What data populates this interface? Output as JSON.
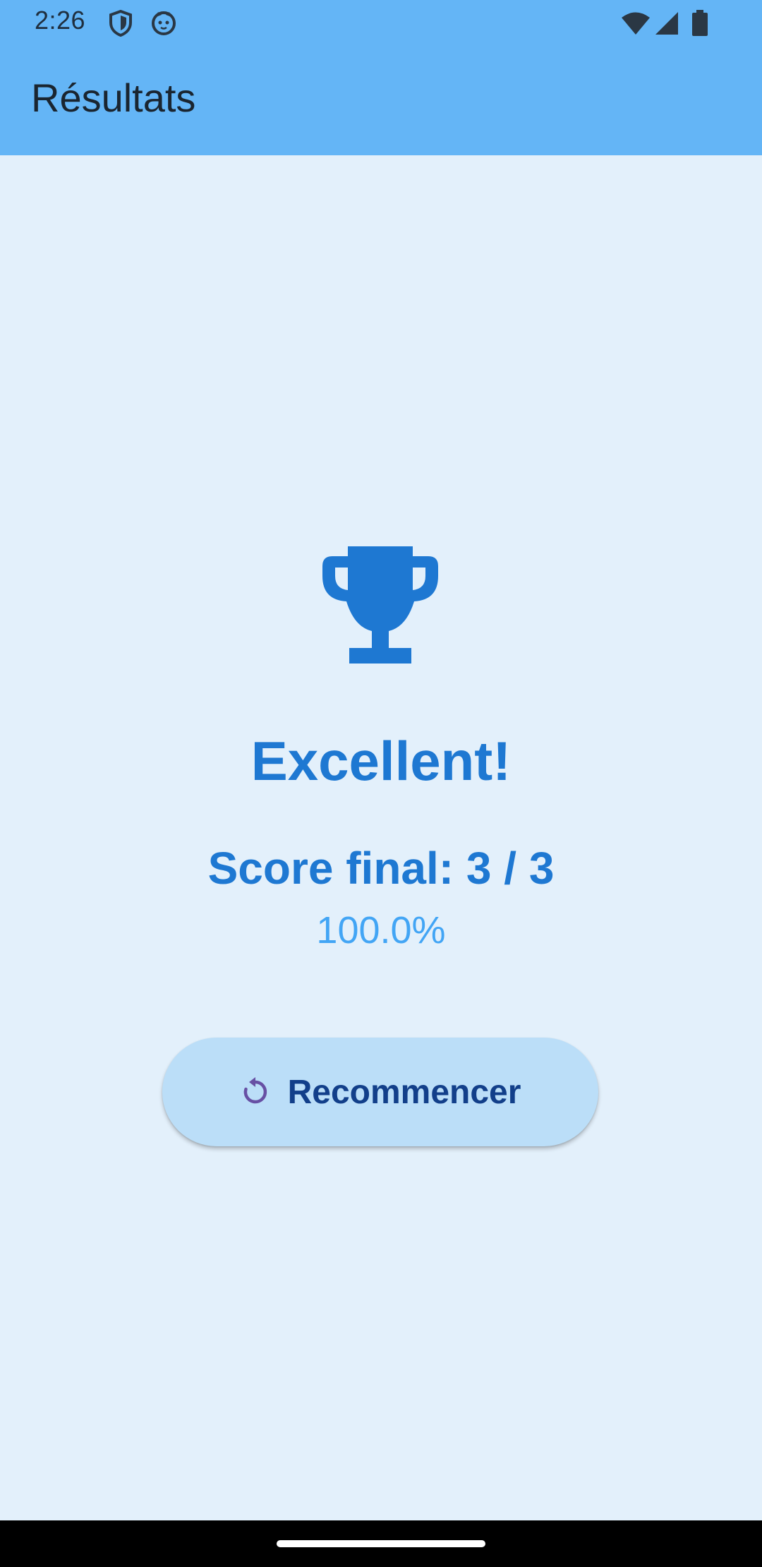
{
  "status_bar": {
    "time": "2:26",
    "left_icons": [
      "shield-icon",
      "cat-face-icon"
    ],
    "right_icons": [
      "wifi-icon",
      "cellular-signal-icon",
      "battery-icon"
    ]
  },
  "app_bar": {
    "title": "Résultats"
  },
  "result": {
    "icon": "trophy-icon",
    "headline": "Excellent!",
    "score_text": "Score final: 3 / 3",
    "percentage_text": "100.0%"
  },
  "actions": {
    "restart_icon": "replay-icon",
    "restart_label": "Recommencer"
  },
  "colors": {
    "app_bar": "#64B5F6",
    "background": "#E3F0FB",
    "primary": "#1E78D2",
    "percent": "#42A5F5",
    "button_bg": "#BBDEF8",
    "button_text": "#123F8A",
    "restart_icon": "#6750A4"
  }
}
